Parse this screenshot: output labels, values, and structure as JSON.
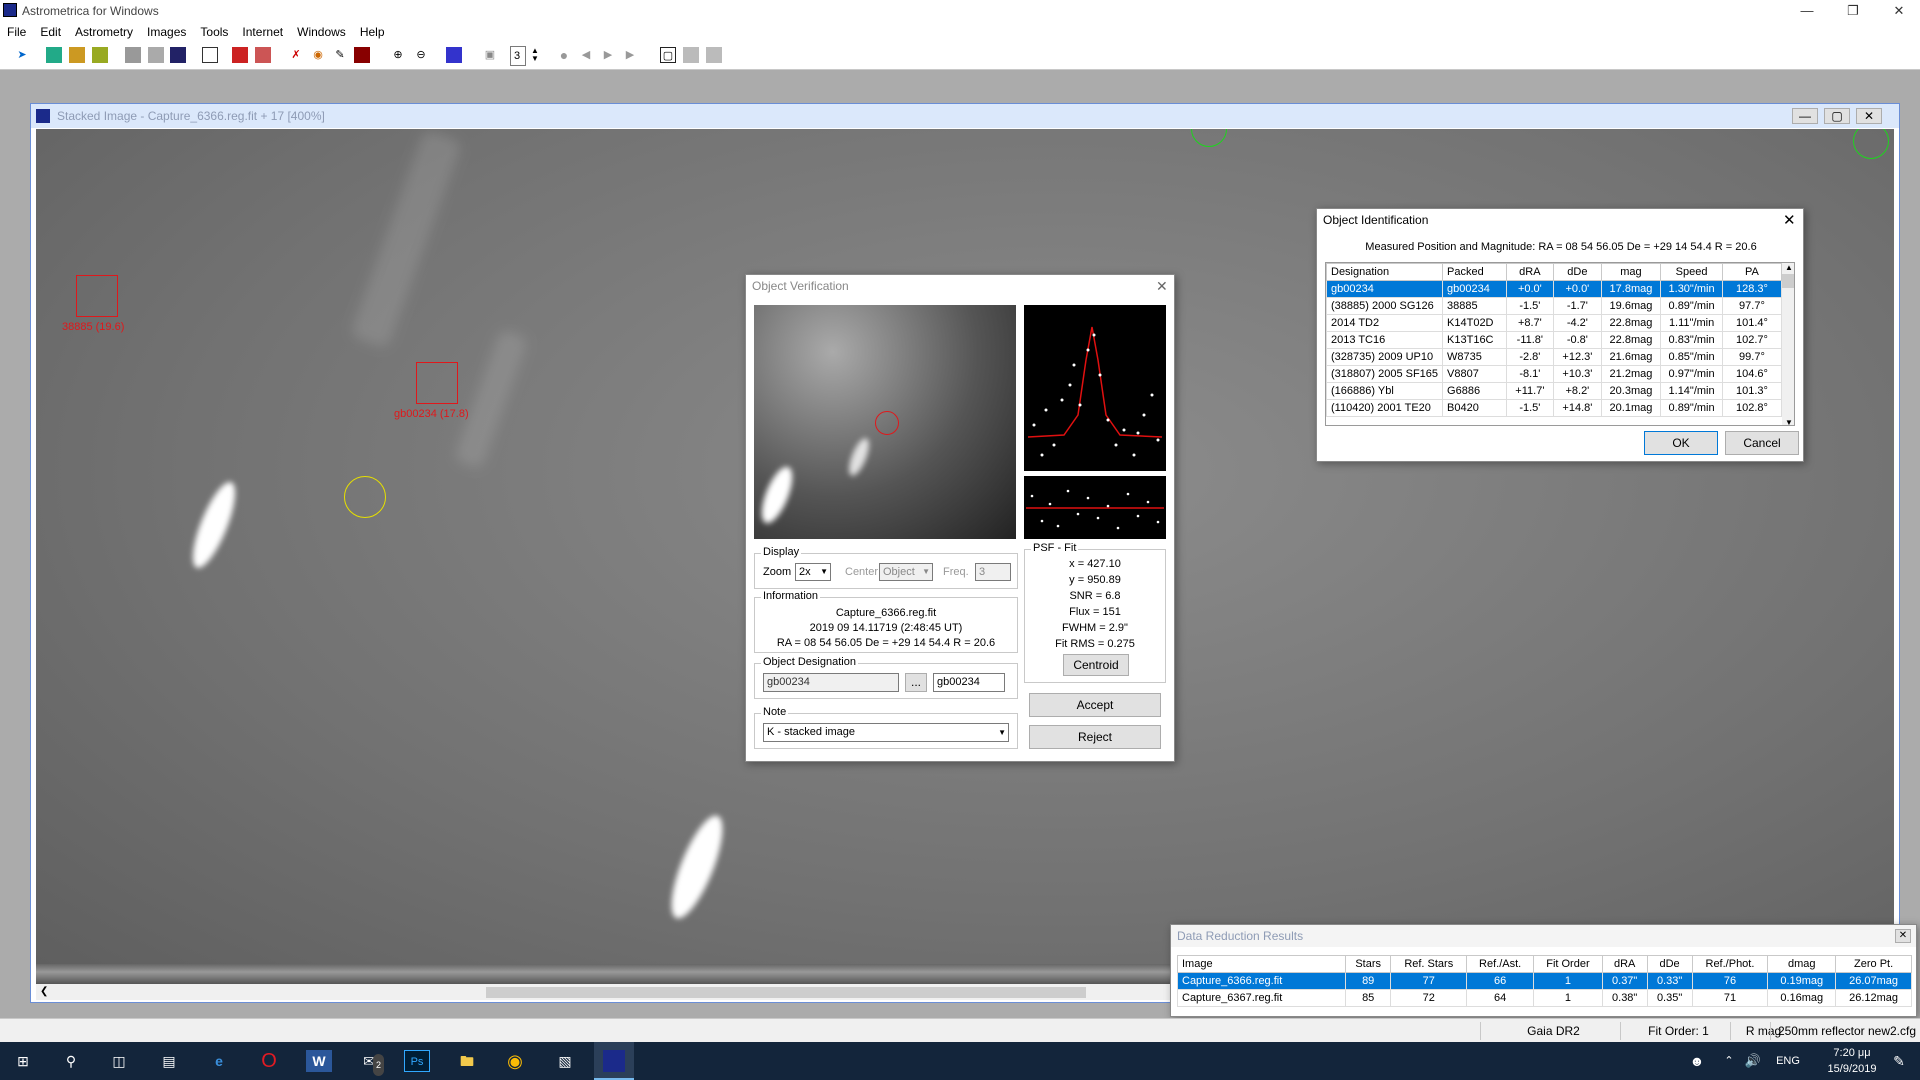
{
  "app": {
    "title": "Astrometrica for Windows"
  },
  "menu": [
    "File",
    "Edit",
    "Astrometry",
    "Images",
    "Tools",
    "Internet",
    "Windows",
    "Help"
  ],
  "toolbar": {
    "freq_value": "3"
  },
  "image_window": {
    "title": "Stacked Image - Capture_6366.reg.fit + 17 [400%]"
  },
  "markers": [
    {
      "label": "38885 (19.6)"
    },
    {
      "label": "gb00234 (17.8)"
    }
  ],
  "object_verification": {
    "title": "Object Verification",
    "display": {
      "group": "Display",
      "zoom_label": "Zoom",
      "zoom_value": "2x",
      "center_label": "Center",
      "center_value": "Object",
      "freq_label": "Freq.",
      "freq_value": "3"
    },
    "information": {
      "group": "Information",
      "line1": "Capture_6366.reg.fit",
      "line2": "2019 09 14.11719 (2:48:45 UT)",
      "line3": "RA = 08 54 56.05   De = +29 14 54.4   R = 20.6"
    },
    "designation": {
      "group": "Object Designation",
      "value": "gb00234",
      "browse": "...",
      "value2": "gb00234"
    },
    "note": {
      "group": "Note",
      "value": "K - stacked image"
    },
    "psf": {
      "group": "PSF - Fit",
      "x": "x = 427.10",
      "y": "y = 950.89",
      "snr": "SNR = 6.8",
      "flux": "Flux = 151",
      "fwhm": "FWHM = 2.9\"",
      "fitrms": "Fit RMS = 0.275",
      "centroid": "Centroid"
    },
    "accept": "Accept",
    "reject": "Reject"
  },
  "object_identification": {
    "title": "Object Identification",
    "measured": "Measured Position and Magnitude: RA = 08 54 56.05   De = +29 14 54.4   R = 20.6",
    "columns": [
      "Designation",
      "Packed",
      "dRA",
      "dDe",
      "mag",
      "Speed",
      "PA"
    ],
    "rows": [
      [
        "gb00234",
        "gb00234",
        "+0.0'",
        "+0.0'",
        "17.8mag",
        "1.30\"/min",
        "128.3°"
      ],
      [
        "(38885) 2000 SG126",
        "38885",
        "-1.5'",
        "-1.7'",
        "19.6mag",
        "0.89\"/min",
        "97.7°"
      ],
      [
        "2014 TD2",
        "K14T02D",
        "+8.7'",
        "-4.2'",
        "22.8mag",
        "1.11\"/min",
        "101.4°"
      ],
      [
        "2013 TC16",
        "K13T16C",
        "-11.8'",
        "-0.8'",
        "22.8mag",
        "0.83\"/min",
        "102.7°"
      ],
      [
        "(328735) 2009 UP10",
        "W8735",
        "-2.8'",
        "+12.3'",
        "21.6mag",
        "0.85\"/min",
        "99.7°"
      ],
      [
        "(318807) 2005 SF165",
        "V8807",
        "-8.1'",
        "+10.3'",
        "21.2mag",
        "0.97\"/min",
        "104.6°"
      ],
      [
        "(166886) Ybl",
        "G6886",
        "+11.7'",
        "+8.2'",
        "20.3mag",
        "1.14\"/min",
        "101.3°"
      ],
      [
        "(110420) 2001 TE20",
        "B0420",
        "-1.5'",
        "+14.8'",
        "20.1mag",
        "0.89\"/min",
        "102.8°"
      ]
    ],
    "ok": "OK",
    "cancel": "Cancel"
  },
  "data_reduction": {
    "title": "Data Reduction Results",
    "columns": [
      "Image",
      "Stars",
      "Ref. Stars",
      "Ref./Ast.",
      "Fit Order",
      "dRA",
      "dDe",
      "Ref./Phot.",
      "dmag",
      "Zero Pt."
    ],
    "rows": [
      [
        "Capture_6366.reg.fit",
        "89",
        "77",
        "66",
        "1",
        "0.37\"",
        "0.33\"",
        "76",
        "0.19mag",
        "26.07mag"
      ],
      [
        "Capture_6367.reg.fit",
        "85",
        "72",
        "64",
        "1",
        "0.38\"",
        "0.35\"",
        "71",
        "0.16mag",
        "26.12mag"
      ]
    ]
  },
  "statusbar": [
    "Gaia DR2",
    "Fit Order: 1",
    "R mag",
    "250mm reflector new2.cfg"
  ],
  "taskbar": {
    "time": "7:20 μμ",
    "date": "15/9/2019",
    "lang": "ENG",
    "mail_badge": "2"
  }
}
